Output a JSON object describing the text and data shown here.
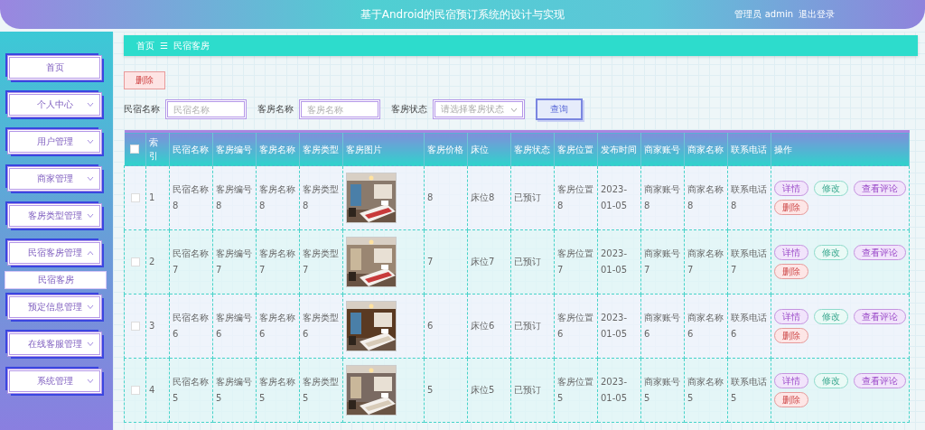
{
  "header": {
    "title": "基于Android的民宿预订系统的设计与实现",
    "user": "管理员 admin",
    "logout": "退出登录"
  },
  "sidebar": {
    "items": [
      {
        "label": "首页",
        "kind": "link"
      },
      {
        "label": "个人中心",
        "kind": "group",
        "expanded": false
      },
      {
        "label": "用户管理",
        "kind": "group",
        "expanded": false
      },
      {
        "label": "商家管理",
        "kind": "group",
        "expanded": false
      },
      {
        "label": "客房类型管理",
        "kind": "group",
        "expanded": false
      },
      {
        "label": "民宿客房管理",
        "kind": "group",
        "expanded": true,
        "children": [
          {
            "label": "民宿客房",
            "selected": true
          }
        ]
      },
      {
        "label": "预定信息管理",
        "kind": "group",
        "expanded": false
      },
      {
        "label": "在线客服管理",
        "kind": "group",
        "expanded": false
      },
      {
        "label": "系统管理",
        "kind": "group",
        "expanded": false
      }
    ]
  },
  "breadcrumb": [
    "首页",
    "民宿客房"
  ],
  "breadcrumb_separator": "☰",
  "toolbar": {
    "delete": "删除"
  },
  "search": {
    "fields": [
      {
        "label": "民宿名称",
        "placeholder": "民宿名称",
        "kind": "text"
      },
      {
        "label": "客房名称",
        "placeholder": "客房名称",
        "kind": "text"
      },
      {
        "label": "客房状态",
        "placeholder": "请选择客房状态",
        "kind": "select"
      }
    ],
    "button": "查询"
  },
  "table": {
    "header_checked": false,
    "columns": [
      "索引",
      "民宿名称",
      "客房编号",
      "客房名称",
      "客房类型",
      "客房图片",
      "客房价格",
      "床位",
      "客房状态",
      "客房位置",
      "发布时间",
      "商家账号",
      "商家名称",
      "联系电话",
      "操作"
    ],
    "rows": [
      {
        "checked": false,
        "cells": [
          "1",
          "民宿名称8",
          "客房编号8",
          "客房名称8",
          "客房类型8",
          {
            "kind": "picture"
          },
          "8",
          "床位8",
          "已预订",
          "客房位置8",
          "2023-01-05",
          "商家账号8",
          "商家名称8",
          "联系电话8"
        ],
        "actions": [
          "详情",
          "修改",
          "查看评论",
          "删除"
        ]
      },
      {
        "checked": false,
        "cells": [
          "2",
          "民宿名称7",
          "客房编号7",
          "客房名称7",
          "客房类型7",
          {
            "kind": "picture"
          },
          "7",
          "床位7",
          "已预订",
          "客房位置7",
          "2023-01-05",
          "商家账号7",
          "商家名称7",
          "联系电话7"
        ],
        "actions": [
          "详情",
          "修改",
          "查看评论",
          "删除"
        ]
      },
      {
        "checked": false,
        "cells": [
          "3",
          "民宿名称6",
          "客房编号6",
          "客房名称6",
          "客房类型6",
          {
            "kind": "picture"
          },
          "6",
          "床位6",
          "已预订",
          "客房位置6",
          "2023-01-05",
          "商家账号6",
          "商家名称6",
          "联系电话6"
        ],
        "actions": [
          "详情",
          "修改",
          "查看评论",
          "删除"
        ]
      },
      {
        "checked": false,
        "cells": [
          "4",
          "民宿名称5",
          "客房编号5",
          "客房名称5",
          "客房类型5",
          {
            "kind": "picture"
          },
          "5",
          "床位5",
          "已预订",
          "客房位置5",
          "2023-01-05",
          "商家账号5",
          "商家名称5",
          "联系电话5"
        ],
        "actions": [
          "详情",
          "修改",
          "查看评论",
          "删除"
        ]
      }
    ]
  }
}
